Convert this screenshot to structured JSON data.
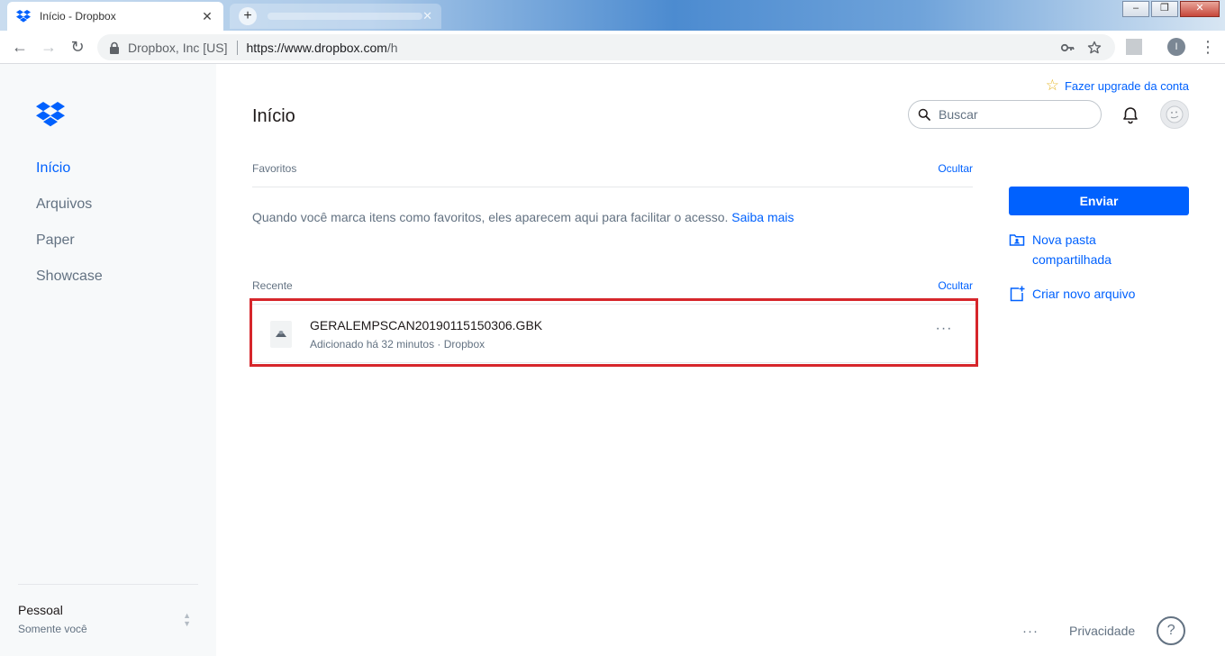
{
  "browser": {
    "tab_title": "Início - Dropbox",
    "tab_close": "✕",
    "new_tab": "+",
    "window_controls": {
      "minimize": "–",
      "restore": "❐",
      "close": "✕"
    },
    "back": "←",
    "forward": "→",
    "reload": "↻",
    "url_org": "Dropbox, Inc [US]",
    "url_scheme_host": "https://www.dropbox.com",
    "url_path": "/h",
    "profile_initial": "I",
    "menu": "⋮"
  },
  "sidebar": {
    "items": [
      {
        "label": "Início",
        "active": true
      },
      {
        "label": "Arquivos",
        "active": false
      },
      {
        "label": "Paper",
        "active": false
      },
      {
        "label": "Showcase",
        "active": false
      }
    ],
    "account": {
      "name": "Pessoal",
      "sub": "Somente você",
      "chevrons": "▲▼"
    }
  },
  "header": {
    "upgrade_label": "Fazer upgrade da conta",
    "title": "Início",
    "search_placeholder": "Buscar"
  },
  "favorites": {
    "heading": "Favoritos",
    "hide": "Ocultar",
    "message": "Quando você marca itens como favoritos, eles aparecem aqui para facilitar o acesso.",
    "learn_more": "Saiba mais"
  },
  "recent": {
    "heading": "Recente",
    "hide": "Ocultar",
    "files": [
      {
        "name": "GERALEMPSCAN20190115150306.GBK",
        "meta": "Adicionado há 32 minutos · Dropbox",
        "more": "···"
      }
    ]
  },
  "actions": {
    "upload": "Enviar",
    "new_shared_folder_line1": "Nova pasta",
    "new_shared_folder_line2": "compartilhada",
    "create_new_file": "Criar novo arquivo"
  },
  "footer": {
    "more": "···",
    "privacy": "Privacidade",
    "help": "?"
  },
  "colors": {
    "accent": "#0061fe",
    "highlight_box": "#d6262b",
    "sidebar_bg": "#f7f9fa",
    "muted_text": "#637282"
  }
}
